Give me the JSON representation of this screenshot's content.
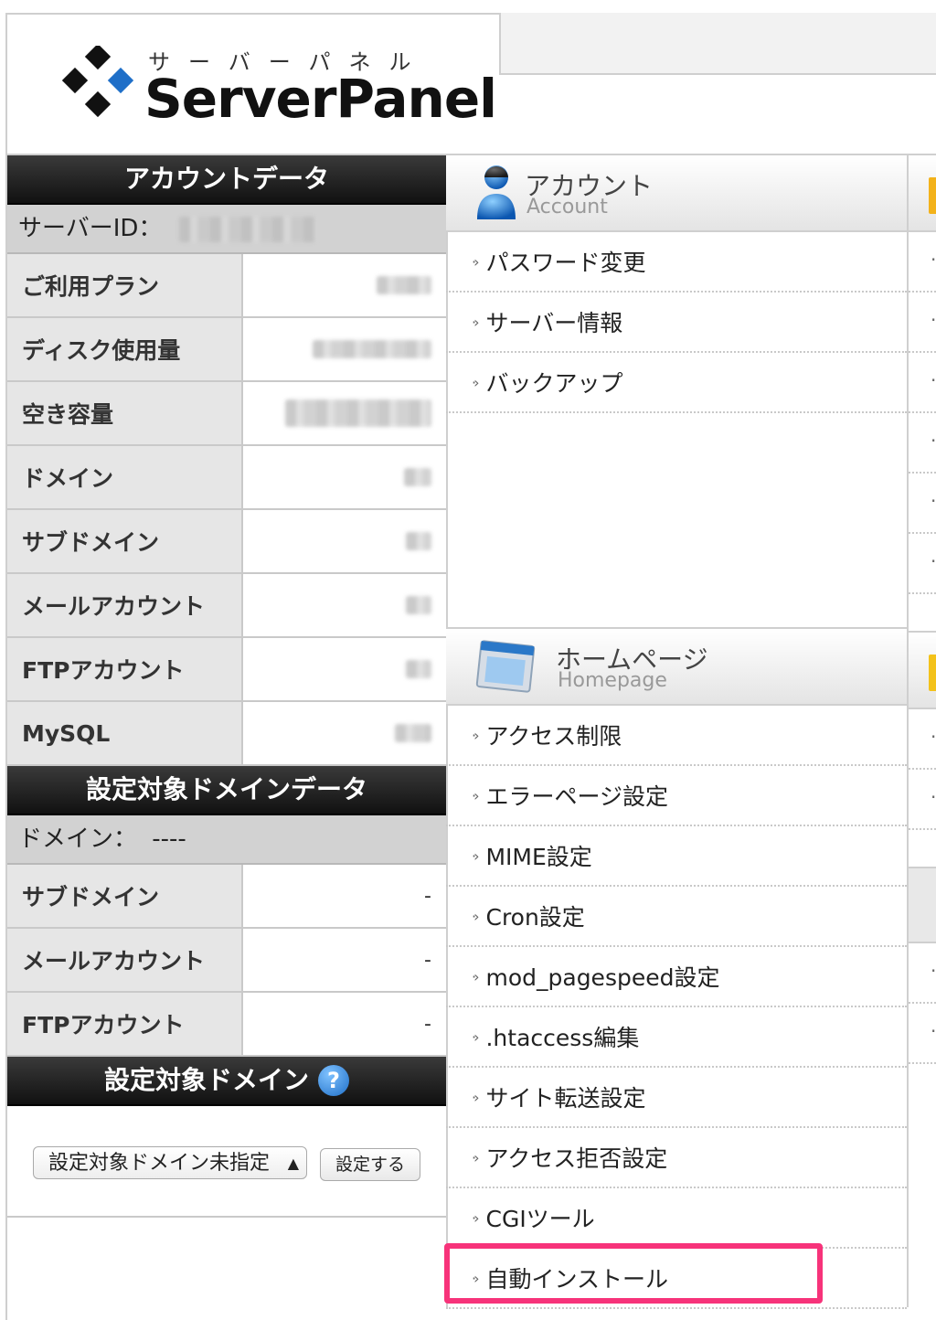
{
  "logo": {
    "kana": "サーバーパネル",
    "name": "ServerPanel"
  },
  "account_data": {
    "title": "アカウントデータ",
    "server_id_label": "サーバーID：",
    "rows": [
      {
        "label": "ご利用プラン"
      },
      {
        "label": "ディスク使用量"
      },
      {
        "label": "空き容量"
      },
      {
        "label": "ドメイン"
      },
      {
        "label": "サブドメイン"
      },
      {
        "label": "メールアカウント"
      },
      {
        "label": "FTPアカウント"
      },
      {
        "label": "MySQL"
      }
    ]
  },
  "target_domain_data": {
    "title": "設定対象ドメインデータ",
    "domain_label": "ドメイン：",
    "domain_value": "----",
    "rows": [
      {
        "label": "サブドメイン",
        "value": "-"
      },
      {
        "label": "メールアカウント",
        "value": "-"
      },
      {
        "label": "FTPアカウント",
        "value": "-"
      }
    ]
  },
  "target_domain": {
    "title": "設定対象ドメイン",
    "help": "?",
    "select_value": "設定対象ドメイン未指定",
    "button": "設定する"
  },
  "account_menu": {
    "title": "アカウント",
    "subtitle": "Account",
    "items": [
      "パスワード変更",
      "サーバー情報",
      "バックアップ"
    ]
  },
  "homepage_menu": {
    "title": "ホームページ",
    "subtitle": "Homepage",
    "items": [
      "アクセス制限",
      "エラーページ設定",
      "MIME設定",
      "Cron設定",
      "mod_pagespeed設定",
      ".htaccess編集",
      "サイト転送設定",
      "アクセス拒否設定",
      "CGIツール",
      "自動インストール"
    ]
  },
  "colors": {
    "highlight": "#f7337a",
    "brand_blue": "#1f6fc8"
  }
}
